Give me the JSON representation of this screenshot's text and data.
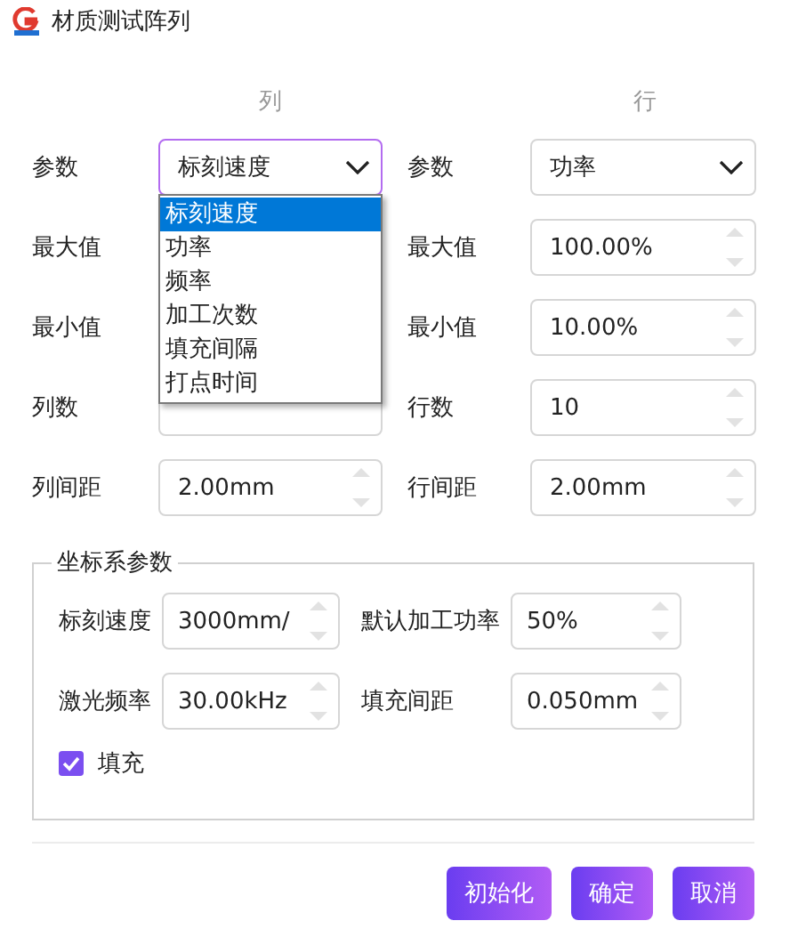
{
  "window": {
    "title": "材质测试阵列"
  },
  "columns": [
    {
      "heading": "列",
      "fields": [
        {
          "label": "参数",
          "kind": "select",
          "value": "标刻速度",
          "expanded": true,
          "options": [
            {
              "label": "标刻速度",
              "selected": true
            },
            {
              "label": "功率",
              "selected": false
            },
            {
              "label": "频率",
              "selected": false
            },
            {
              "label": "加工次数",
              "selected": false
            },
            {
              "label": "填充间隔",
              "selected": false
            },
            {
              "label": "打点时间",
              "selected": false
            }
          ]
        },
        {
          "label": "最大值"
        },
        {
          "label": "最小值"
        },
        {
          "label": "列数",
          "kind": "number"
        },
        {
          "label": "列间距",
          "kind": "number",
          "value": "2.00mm"
        }
      ]
    },
    {
      "heading": "行",
      "fields": [
        {
          "label": "参数",
          "kind": "select",
          "value": "功率",
          "expanded": false
        },
        {
          "label": "最大值",
          "kind": "number",
          "value": "100.00%"
        },
        {
          "label": "最小值",
          "kind": "number",
          "value": "10.00%"
        },
        {
          "label": "行数",
          "kind": "number",
          "value": "10"
        },
        {
          "label": "行间距",
          "kind": "number",
          "value": "2.00mm"
        }
      ]
    }
  ],
  "group": {
    "title": "坐标系参数",
    "fields": [
      {
        "label": "标刻速度",
        "value": "3000mm/"
      },
      {
        "label": "默认加工功率",
        "value": "50%"
      },
      {
        "label": "激光频率",
        "value": "30.00kHz"
      },
      {
        "label": "填充间距",
        "value": "0.050mm"
      }
    ],
    "checkbox": {
      "label": "填充",
      "checked": true
    }
  },
  "buttons": [
    "初始化",
    "确定",
    "取消"
  ]
}
